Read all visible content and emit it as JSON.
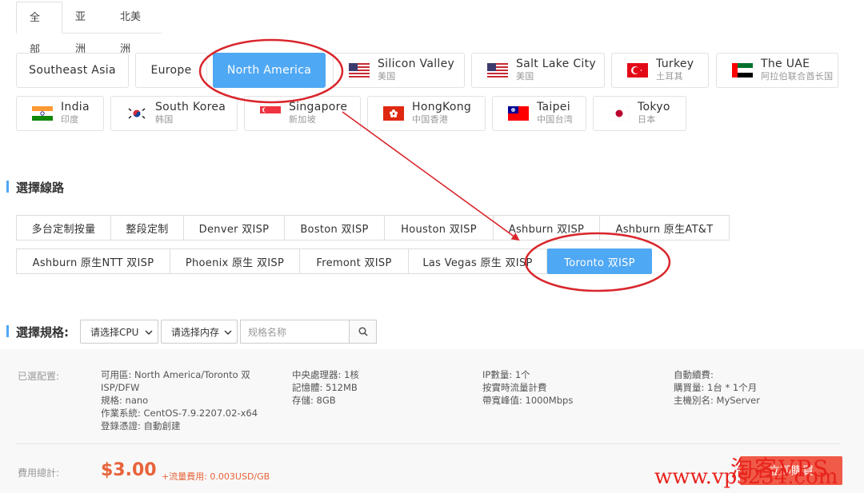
{
  "tabs": [
    "全部",
    "亚洲",
    "北美洲"
  ],
  "regions": {
    "southeast_asia": {
      "name": "Southeast Asia"
    },
    "europe": {
      "name": "Europe"
    },
    "north_america": {
      "name": "North America"
    },
    "silicon_valley": {
      "name": "Silicon Valley",
      "sub": "美国",
      "flag": "us-flag-icon"
    },
    "salt_lake_city": {
      "name": "Salt Lake City",
      "sub": "美国",
      "flag": "us-flag-icon"
    },
    "turkey": {
      "name": "Turkey",
      "sub": "土耳其",
      "flag": "turkey-flag-icon"
    },
    "uae": {
      "name": "The UAE",
      "sub": "阿拉伯联合酋长国",
      "flag": "uae-flag-icon"
    },
    "india": {
      "name": "India",
      "sub": "印度",
      "flag": "india-flag-icon"
    },
    "south_korea": {
      "name": "South Korea",
      "sub": "韩国",
      "flag": "south-korea-flag-icon"
    },
    "singapore": {
      "name": "Singapore",
      "sub": "新加坡",
      "flag": "singapore-flag-icon"
    },
    "hongkong": {
      "name": "HongKong",
      "sub": "中国香港",
      "flag": "hongkong-flag-icon"
    },
    "taipei": {
      "name": "Taipei",
      "sub": "中国台湾",
      "flag": "taiwan-flag-icon"
    },
    "tokyo": {
      "name": "Tokyo",
      "sub": "日本",
      "flag": "japan-flag-icon"
    }
  },
  "route_title": "選擇線路",
  "routes": {
    "r1": "多台定制按量",
    "r2": "整段定制",
    "r3": "Denver 双ISP",
    "r4": "Boston 双ISP",
    "r5": "Houston 双ISP",
    "r6": "Ashburn 双ISP",
    "r7": "Ashburn 原生AT&T",
    "r8": "Ashburn 原生NTT 双ISP",
    "r9": "Phoenix 原生 双ISP",
    "r10": "Fremont 双ISP",
    "r11": "Las Vegas 原生 双ISP",
    "r12": "Toronto 双ISP"
  },
  "spec": {
    "title": "選擇規格:",
    "cpu_select": "请选择CPU",
    "mem_select": "请选择内存",
    "search_placeholder": "规格名称"
  },
  "summary": {
    "selected_label": "已選配置:",
    "col1": [
      "可用區: North America/Toronto 双",
      "ISP/DFW",
      "規格: nano",
      "作業系統: CentOS-7.9.2207.02-x64",
      "登錄憑證: 自動創建"
    ],
    "col2": [
      "中央處理器: 1核",
      "記憶體: 512MB",
      "存儲: 8GB"
    ],
    "col3": [
      "IP數量: 1个",
      "按實時流量計費",
      "帶寬峰值: 1000Mbps"
    ],
    "col4": [
      "自動續費:",
      "購買量: 1台 * 1个月",
      "主機別名: MyServer"
    ],
    "total_label": "費用總計:",
    "price": "$3.00",
    "traffic_fee": "+流量費用: 0.003USD/GB",
    "buy_label": "立即購買"
  },
  "watermark": {
    "cn": "淘客VPS",
    "url": "www.vps234.com"
  },
  "colors": {
    "accent": "#4fa8f4",
    "annotation": "#d9262c",
    "price": "#e8633a"
  }
}
